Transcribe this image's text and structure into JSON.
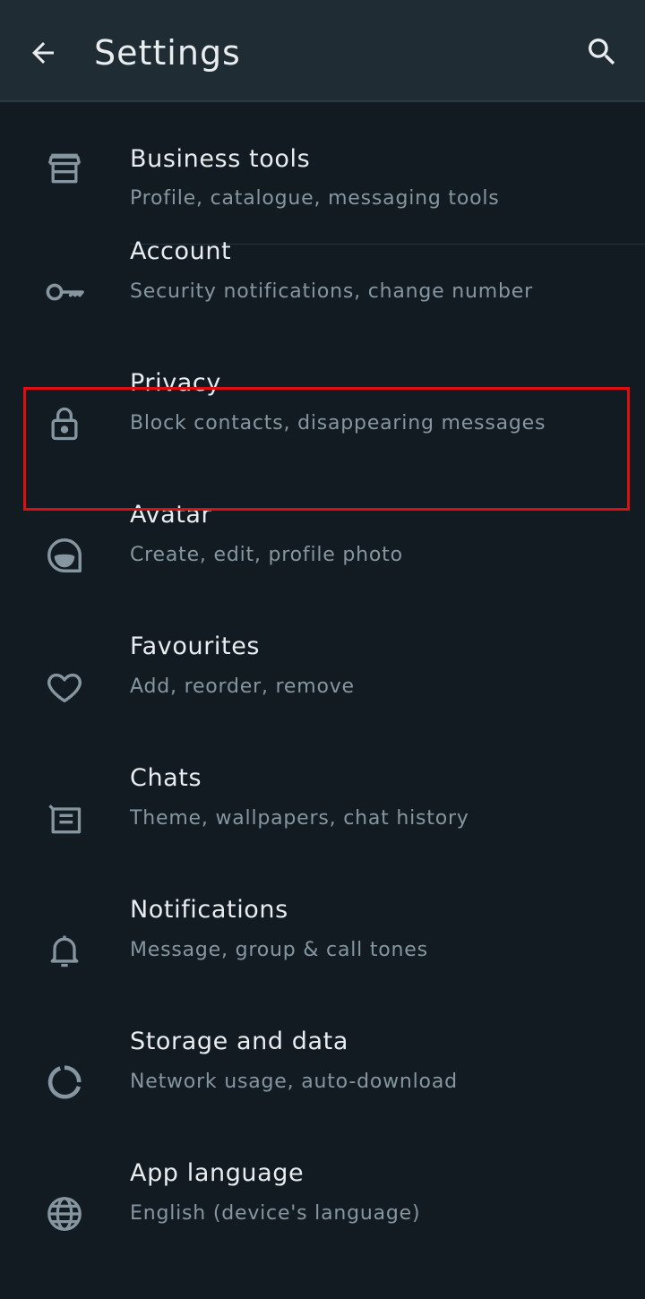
{
  "header": {
    "title": "Settings",
    "back_icon": "arrow-left-icon",
    "search_icon": "search-icon"
  },
  "colors": {
    "background": "#121b22",
    "appbar": "#1f2c33",
    "text_primary": "#e9edef",
    "text_secondary": "#8696a0",
    "highlight": "#e00f0f"
  },
  "items": [
    {
      "label": "Business tools",
      "sub": "Profile, catalogue, messaging tools",
      "icon": "storefront-icon"
    },
    {
      "label": "Account",
      "sub": "Security notifications, change number",
      "icon": "key-icon"
    },
    {
      "label": "Privacy",
      "sub": "Block contacts, disappearing messages",
      "icon": "lock-icon"
    },
    {
      "label": "Avatar",
      "sub": "Create, edit, profile photo",
      "icon": "avatar-icon"
    },
    {
      "label": "Favourites",
      "sub": "Add, reorder, remove",
      "icon": "heart-icon"
    },
    {
      "label": "Chats",
      "sub": "Theme, wallpapers, chat history",
      "icon": "chat-icon"
    },
    {
      "label": "Notifications",
      "sub": "Message, group & call tones",
      "icon": "bell-icon"
    },
    {
      "label": "Storage and data",
      "sub": "Network usage, auto-download",
      "icon": "storage-icon"
    },
    {
      "label": "App language",
      "sub": "English (device's language)",
      "icon": "globe-icon"
    }
  ],
  "highlighted_item": "Privacy"
}
